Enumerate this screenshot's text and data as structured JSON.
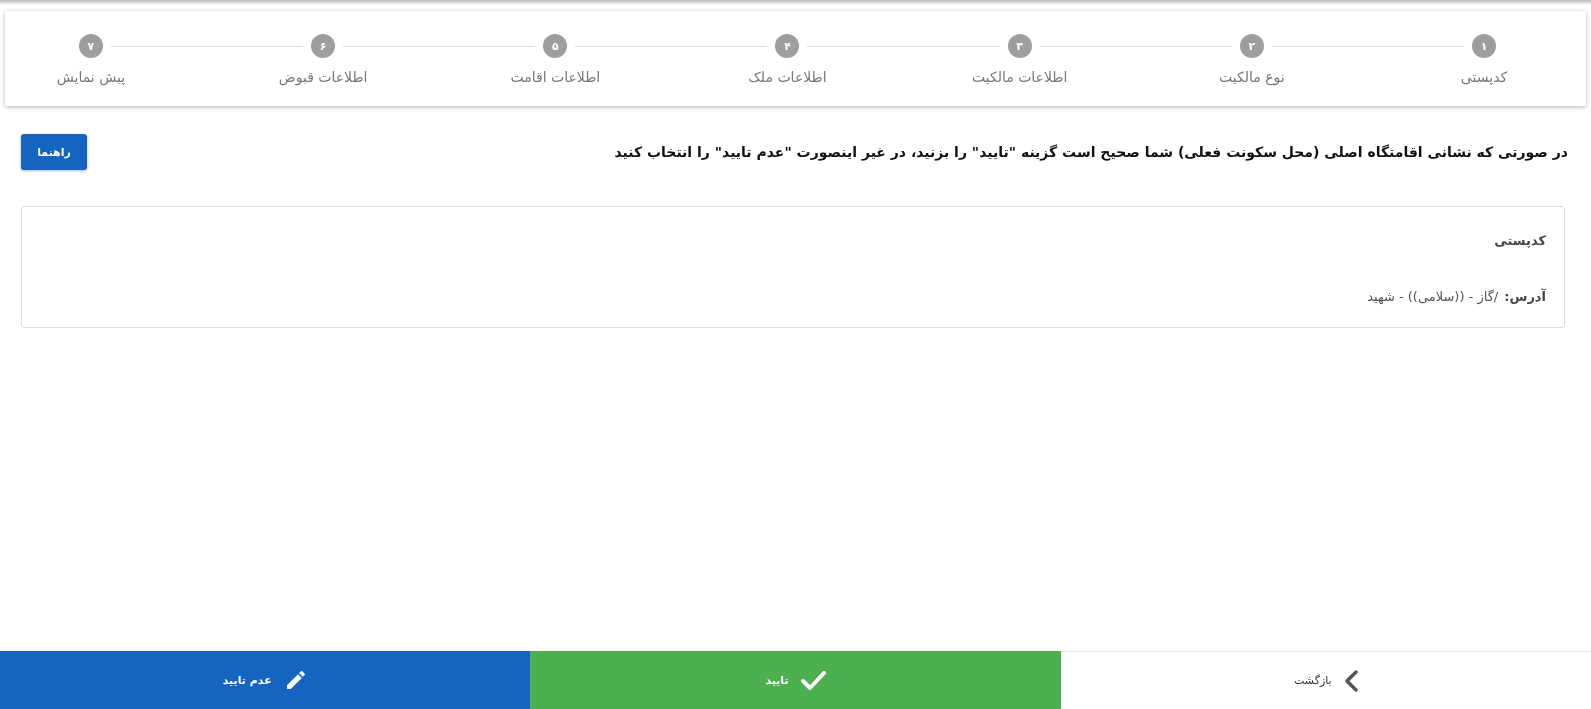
{
  "stepper": {
    "steps": [
      {
        "number": "۱",
        "label": "کدپستی"
      },
      {
        "number": "۲",
        "label": "نوع مالکیت"
      },
      {
        "number": "۳",
        "label": "اطلاعات مالکیت"
      },
      {
        "number": "۴",
        "label": "اطلاعات ملک"
      },
      {
        "number": "۵",
        "label": "اطلاعات اقامت"
      },
      {
        "number": "۶",
        "label": "اطلاعات قبوض"
      },
      {
        "number": "۷",
        "label": "پیش نمایش"
      }
    ]
  },
  "instruction": {
    "text": "در صورتی که نشانی اقامتگاه اصلی (محل سکونت فعلی) شما صحیح است گزینه \"تایید\" را بزنید، در غیر اینصورت \"عدم تایید\" را انتخاب کنید",
    "help_button": "راهنما"
  },
  "address_card": {
    "fields": [
      {
        "label": "کدپستی"
      },
      {
        "label": "آدرس:",
        "value": "/گاز - ((سلامی)) - شهید"
      }
    ]
  },
  "actions": [
    {
      "kind": "back",
      "label": "بازگشت"
    },
    {
      "kind": "confirm",
      "label": "تایید"
    },
    {
      "kind": "reject",
      "label": "عدم تایید"
    }
  ]
}
